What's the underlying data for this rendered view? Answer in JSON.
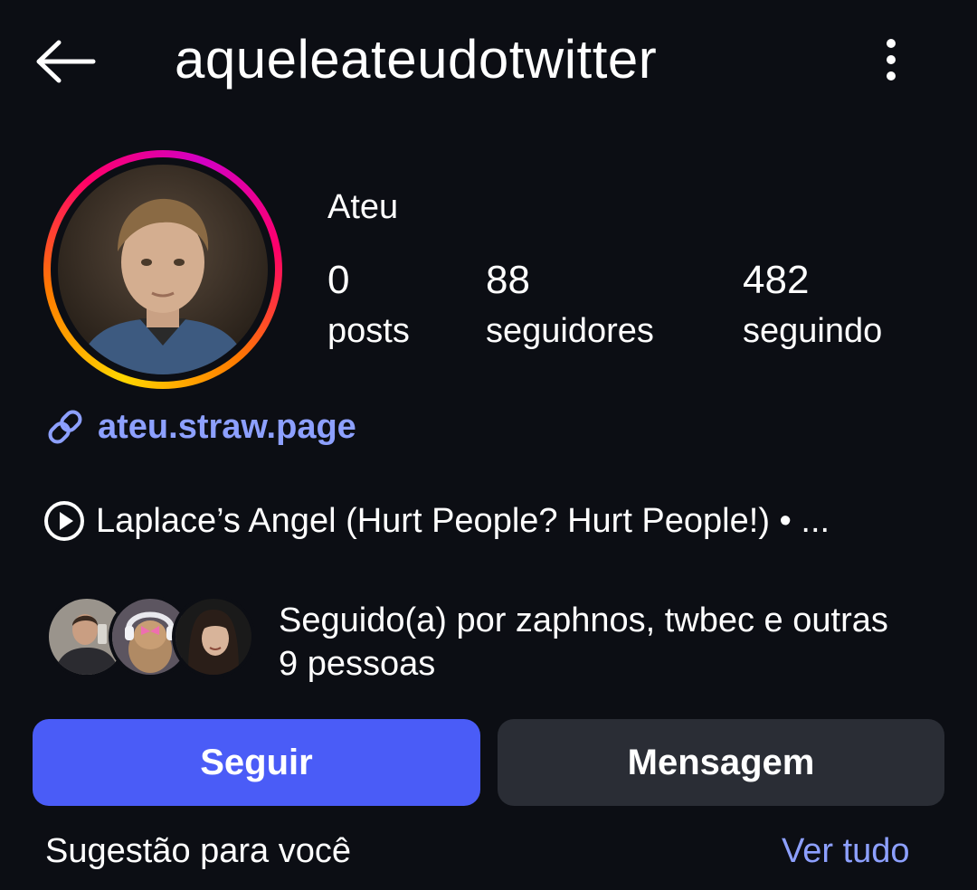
{
  "header": {
    "username": "aqueleateudotwitter"
  },
  "profile": {
    "display_name": "Ateu",
    "stats": [
      {
        "value": "0",
        "label": "posts"
      },
      {
        "value": "88",
        "label": "seguidores"
      },
      {
        "value": "482",
        "label": "seguindo"
      }
    ],
    "link": "ateu.straw.page",
    "music": "Laplace’s Angel (Hurt People? Hurt People!) • ..."
  },
  "followed_by": {
    "text": "Seguido(a) por zaphnos, twbec e outras 9 pessoas"
  },
  "actions": {
    "follow_label": "Seguir",
    "message_label": "Mensagem"
  },
  "suggestions": {
    "title": "Sugestão para você",
    "see_all_label": "Ver tudo"
  },
  "colors": {
    "background": "#0c0e14",
    "primary_button": "#4a5cf7",
    "secondary_button": "#2a2d35",
    "link": "#8da0ff"
  }
}
